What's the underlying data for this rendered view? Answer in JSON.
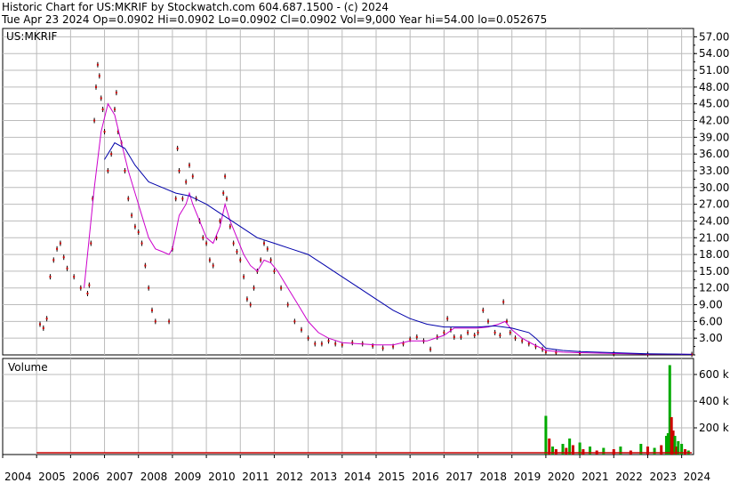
{
  "header": {
    "line1": "Historic Chart for US:MKRIF by Stockwatch.com 604.687.1500 - (c) 2024",
    "line2": "Tue Apr 23 2024   Op=0.0902   Hi=0.0902   Lo=0.0902   Cl=0.0902   Vol=9,000   Year hi=54.00   lo=0.052675"
  },
  "chart_data": [
    {
      "type": "line",
      "title": "US:MKRIF",
      "y_ticks": [
        "57.00",
        "54.00",
        "51.00",
        "48.00",
        "45.00",
        "42.00",
        "39.00",
        "36.00",
        "33.00",
        "30.00",
        "27.00",
        "24.00",
        "21.00",
        "18.00",
        "15.00",
        "12.00",
        "9.00",
        "6.00",
        "3.00"
      ],
      "ylim": [
        0,
        58.5
      ],
      "xlim": [
        2004.0,
        2024.35
      ],
      "grid": true,
      "series": [
        {
          "style": "price-ohlc",
          "color": "#cc0000",
          "points": [
            [
              2005.1,
              5.5
            ],
            [
              2005.2,
              4.8
            ],
            [
              2005.3,
              6.5
            ],
            [
              2005.4,
              14
            ],
            [
              2005.5,
              17
            ],
            [
              2005.6,
              19
            ],
            [
              2005.7,
              20
            ],
            [
              2005.8,
              17.5
            ],
            [
              2005.9,
              15.5
            ],
            [
              2006.1,
              14
            ],
            [
              2006.3,
              12
            ],
            [
              2006.5,
              11
            ],
            [
              2006.55,
              12.5
            ],
            [
              2006.6,
              20
            ],
            [
              2006.65,
              28
            ],
            [
              2006.7,
              42
            ],
            [
              2006.75,
              48
            ],
            [
              2006.8,
              52
            ],
            [
              2006.85,
              50
            ],
            [
              2006.9,
              46
            ],
            [
              2006.95,
              44
            ],
            [
              2007.0,
              40
            ],
            [
              2007.1,
              33
            ],
            [
              2007.2,
              36
            ],
            [
              2007.3,
              44
            ],
            [
              2007.35,
              47
            ],
            [
              2007.4,
              40
            ],
            [
              2007.5,
              38
            ],
            [
              2007.6,
              33
            ],
            [
              2007.7,
              28
            ],
            [
              2007.8,
              25
            ],
            [
              2007.9,
              23
            ],
            [
              2008.0,
              22
            ],
            [
              2008.1,
              20
            ],
            [
              2008.2,
              16
            ],
            [
              2008.3,
              12
            ],
            [
              2008.4,
              8
            ],
            [
              2008.5,
              6
            ],
            [
              2008.9,
              6
            ],
            [
              2009.0,
              19
            ],
            [
              2009.1,
              28
            ],
            [
              2009.15,
              37
            ],
            [
              2009.2,
              33
            ],
            [
              2009.3,
              28
            ],
            [
              2009.4,
              31
            ],
            [
              2009.5,
              34
            ],
            [
              2009.6,
              32
            ],
            [
              2009.7,
              28
            ],
            [
              2009.8,
              24
            ],
            [
              2009.9,
              21
            ],
            [
              2010.0,
              20
            ],
            [
              2010.1,
              17
            ],
            [
              2010.2,
              16
            ],
            [
              2010.3,
              21
            ],
            [
              2010.4,
              24
            ],
            [
              2010.5,
              29
            ],
            [
              2010.55,
              32
            ],
            [
              2010.6,
              28
            ],
            [
              2010.7,
              23
            ],
            [
              2010.8,
              20
            ],
            [
              2010.9,
              18.5
            ],
            [
              2011.0,
              17
            ],
            [
              2011.1,
              14
            ],
            [
              2011.2,
              10
            ],
            [
              2011.3,
              9
            ],
            [
              2011.4,
              12
            ],
            [
              2011.5,
              15
            ],
            [
              2011.6,
              17
            ],
            [
              2011.7,
              20
            ],
            [
              2011.8,
              19
            ],
            [
              2011.9,
              17
            ],
            [
              2012.0,
              15
            ],
            [
              2012.2,
              12
            ],
            [
              2012.4,
              9
            ],
            [
              2012.6,
              6
            ],
            [
              2012.8,
              4.5
            ],
            [
              2013.0,
              3
            ],
            [
              2013.2,
              2
            ],
            [
              2013.4,
              2
            ],
            [
              2013.6,
              2.5
            ],
            [
              2013.8,
              2
            ],
            [
              2014.0,
              1.8
            ],
            [
              2014.3,
              2.2
            ],
            [
              2014.6,
              2
            ],
            [
              2014.9,
              1.6
            ],
            [
              2015.2,
              1.2
            ],
            [
              2015.5,
              1.5
            ],
            [
              2015.8,
              2
            ],
            [
              2016.0,
              2.8
            ],
            [
              2016.2,
              3.2
            ],
            [
              2016.4,
              2.5
            ],
            [
              2016.6,
              1
            ],
            [
              2016.8,
              3.2
            ],
            [
              2017.0,
              4
            ],
            [
              2017.1,
              6.5
            ],
            [
              2017.2,
              4.5
            ],
            [
              2017.3,
              3.2
            ],
            [
              2017.5,
              3.2
            ],
            [
              2017.7,
              4
            ],
            [
              2017.9,
              3.5
            ],
            [
              2018.0,
              4
            ],
            [
              2018.15,
              8
            ],
            [
              2018.3,
              6
            ],
            [
              2018.5,
              4
            ],
            [
              2018.65,
              3.5
            ],
            [
              2018.75,
              9.5
            ],
            [
              2018.85,
              6
            ],
            [
              2018.95,
              4
            ],
            [
              2019.1,
              3
            ],
            [
              2019.3,
              2.5
            ],
            [
              2019.5,
              2
            ],
            [
              2019.7,
              1.5
            ],
            [
              2019.9,
              1
            ],
            [
              2020.0,
              0.5
            ],
            [
              2020.3,
              0.4
            ],
            [
              2021.0,
              0.3
            ],
            [
              2022.0,
              0.2
            ],
            [
              2023.0,
              0.1
            ],
            [
              2024.3,
              0.09
            ]
          ]
        },
        {
          "style": "moving-average-short",
          "color": "#cc00cc",
          "points": [
            [
              2006.4,
              12
            ],
            [
              2006.7,
              30
            ],
            [
              2006.9,
              40
            ],
            [
              2007.1,
              45
            ],
            [
              2007.3,
              43
            ],
            [
              2007.5,
              38
            ],
            [
              2007.7,
              33
            ],
            [
              2007.9,
              29
            ],
            [
              2008.1,
              25
            ],
            [
              2008.3,
              21
            ],
            [
              2008.5,
              19
            ],
            [
              2008.7,
              18.5
            ],
            [
              2008.9,
              18
            ],
            [
              2009.0,
              19
            ],
            [
              2009.2,
              25
            ],
            [
              2009.4,
              27
            ],
            [
              2009.5,
              29
            ],
            [
              2009.6,
              27
            ],
            [
              2009.8,
              24
            ],
            [
              2010.0,
              21
            ],
            [
              2010.2,
              20
            ],
            [
              2010.4,
              23
            ],
            [
              2010.55,
              27
            ],
            [
              2010.7,
              24
            ],
            [
              2010.9,
              21
            ],
            [
              2011.1,
              18
            ],
            [
              2011.3,
              16
            ],
            [
              2011.5,
              15
            ],
            [
              2011.7,
              17
            ],
            [
              2011.9,
              16.5
            ],
            [
              2012.1,
              15
            ],
            [
              2012.4,
              12
            ],
            [
              2012.7,
              9
            ],
            [
              2013.0,
              6
            ],
            [
              2013.3,
              4
            ],
            [
              2013.6,
              3
            ],
            [
              2014.0,
              2.2
            ],
            [
              2014.5,
              2
            ],
            [
              2015.0,
              1.8
            ],
            [
              2015.5,
              1.8
            ],
            [
              2016.0,
              2.5
            ],
            [
              2016.5,
              2.5
            ],
            [
              2017.0,
              3.5
            ],
            [
              2017.3,
              4.8
            ],
            [
              2017.6,
              4.8
            ],
            [
              2018.0,
              4.8
            ],
            [
              2018.3,
              5
            ],
            [
              2018.6,
              5.5
            ],
            [
              2018.8,
              6
            ],
            [
              2019.0,
              4.5
            ],
            [
              2019.3,
              3
            ],
            [
              2019.6,
              2
            ],
            [
              2020.0,
              0.8
            ],
            [
              2020.5,
              0.5
            ],
            [
              2021.0,
              0.4
            ],
            [
              2022.0,
              0.25
            ],
            [
              2023.0,
              0.15
            ],
            [
              2024.3,
              0.1
            ]
          ]
        },
        {
          "style": "moving-average-long",
          "color": "#0000aa",
          "points": [
            [
              2007.0,
              35
            ],
            [
              2007.3,
              38
            ],
            [
              2007.6,
              37
            ],
            [
              2007.9,
              34
            ],
            [
              2008.3,
              31
            ],
            [
              2008.7,
              30
            ],
            [
              2009.1,
              29
            ],
            [
              2009.5,
              28.5
            ],
            [
              2010.0,
              27
            ],
            [
              2010.5,
              25
            ],
            [
              2011.0,
              23
            ],
            [
              2011.5,
              21
            ],
            [
              2012.0,
              20
            ],
            [
              2012.5,
              19
            ],
            [
              2013.0,
              18
            ],
            [
              2013.5,
              16
            ],
            [
              2014.0,
              14
            ],
            [
              2014.5,
              12
            ],
            [
              2015.0,
              10
            ],
            [
              2015.5,
              8
            ],
            [
              2016.0,
              6.5
            ],
            [
              2016.5,
              5.5
            ],
            [
              2017.0,
              5
            ],
            [
              2017.5,
              5
            ],
            [
              2018.0,
              5
            ],
            [
              2018.5,
              5.2
            ],
            [
              2019.0,
              4.8
            ],
            [
              2019.5,
              4
            ],
            [
              2019.7,
              3
            ],
            [
              2020.0,
              1.2
            ],
            [
              2020.5,
              0.8
            ],
            [
              2021.0,
              0.6
            ],
            [
              2022.0,
              0.4
            ],
            [
              2023.0,
              0.2
            ],
            [
              2024.3,
              0.1
            ]
          ]
        }
      ]
    },
    {
      "type": "bar",
      "title": "Volume",
      "y_ticks": [
        "600 k",
        "400 k",
        "200 k"
      ],
      "ylim": [
        0,
        720000
      ],
      "x_ticks": [
        "2004",
        "2005",
        "2006",
        "2007",
        "2008",
        "2009",
        "2010",
        "2011",
        "2012",
        "2013",
        "2014",
        "2015",
        "2016",
        "2017",
        "2018",
        "2019",
        "2020",
        "2021",
        "2022",
        "2023",
        "2024"
      ],
      "series": [
        {
          "name": "",
          "points": [
            [
              2020.0,
              290000,
              "g"
            ],
            [
              2020.1,
              120000,
              "r"
            ],
            [
              2020.2,
              60000,
              "g"
            ],
            [
              2020.3,
              40000,
              "r"
            ],
            [
              2020.5,
              80000,
              "g"
            ],
            [
              2020.6,
              50000,
              "r"
            ],
            [
              2020.7,
              120000,
              "g"
            ],
            [
              2020.8,
              70000,
              "r"
            ],
            [
              2021.0,
              90000,
              "g"
            ],
            [
              2021.1,
              40000,
              "r"
            ],
            [
              2021.3,
              60000,
              "g"
            ],
            [
              2021.5,
              30000,
              "r"
            ],
            [
              2021.7,
              50000,
              "g"
            ],
            [
              2022.0,
              40000,
              "r"
            ],
            [
              2022.2,
              60000,
              "g"
            ],
            [
              2022.5,
              30000,
              "r"
            ],
            [
              2022.8,
              80000,
              "g"
            ],
            [
              2023.0,
              60000,
              "r"
            ],
            [
              2023.2,
              50000,
              "g"
            ],
            [
              2023.4,
              70000,
              "r"
            ],
            [
              2023.55,
              140000,
              "g"
            ],
            [
              2023.6,
              160000,
              "g"
            ],
            [
              2023.65,
              670000,
              "g"
            ],
            [
              2023.7,
              280000,
              "r"
            ],
            [
              2023.75,
              180000,
              "r"
            ],
            [
              2023.8,
              140000,
              "g"
            ],
            [
              2023.85,
              60000,
              "r"
            ],
            [
              2023.9,
              100000,
              "g"
            ],
            [
              2024.0,
              80000,
              "g"
            ],
            [
              2024.1,
              40000,
              "r"
            ],
            [
              2024.2,
              30000,
              "g"
            ]
          ]
        }
      ]
    }
  ]
}
